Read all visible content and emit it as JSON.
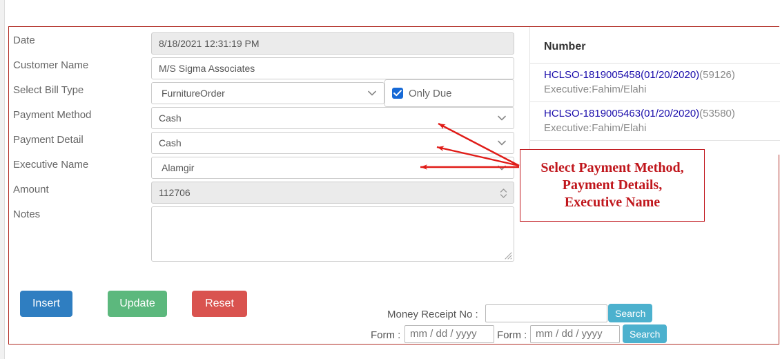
{
  "form": {
    "fields": [
      {
        "label": "Date",
        "value": "8/18/2021 12:31:19 PM",
        "kind": "readonly"
      },
      {
        "label": "Customer Name",
        "value": "M/S Sigma Associates",
        "kind": "text"
      },
      {
        "label": "Select Bill Type",
        "value": "FurnitureOrder",
        "kind": "select"
      },
      {
        "label": "Payment Method",
        "value": "Cash",
        "kind": "select"
      },
      {
        "label": "Payment Detail",
        "value": "Cash",
        "kind": "select"
      },
      {
        "label": "Executive Name",
        "value": "Alamgir",
        "kind": "select"
      },
      {
        "label": "Amount",
        "value": "112706",
        "kind": "number-readonly"
      },
      {
        "label": "Notes",
        "value": "",
        "kind": "textarea"
      }
    ],
    "only_due": {
      "label": "Only Due",
      "checked": true
    }
  },
  "buttons": {
    "insert": "Insert",
    "update": "Update",
    "reset": "Reset"
  },
  "search": {
    "money_receipt_label": "Money Receipt No :",
    "money_receipt_value": "",
    "money_receipt_search": "Search",
    "from_label_1": "Form :",
    "from_value_1": "mm / dd / yyyy",
    "from_label_2": "Form :",
    "from_value_2": "mm / dd / yyyy",
    "date_search": "Search"
  },
  "list": {
    "header": "Number",
    "items": [
      {
        "number": "HCLSO-1819005458(01/20/2020)",
        "count": "(59126)",
        "executive": "Executive:Fahim/Elahi"
      },
      {
        "number": "HCLSO-1819005463(01/20/2020)",
        "count": "(53580)",
        "executive": "Executive:Fahim/Elahi"
      }
    ]
  },
  "annotation": {
    "line1": "Select Payment Method,",
    "line2": "Payment Details,",
    "line3": "Executive Name",
    "color": "#c0161c"
  },
  "colors": {
    "panel_border": "#b02a22",
    "insert": "#2f7ec1",
    "update": "#5cb87d",
    "reset": "#d9534f",
    "search": "#4cb1ce",
    "link": "#1a0dab",
    "checkbox": "#1669d6"
  }
}
